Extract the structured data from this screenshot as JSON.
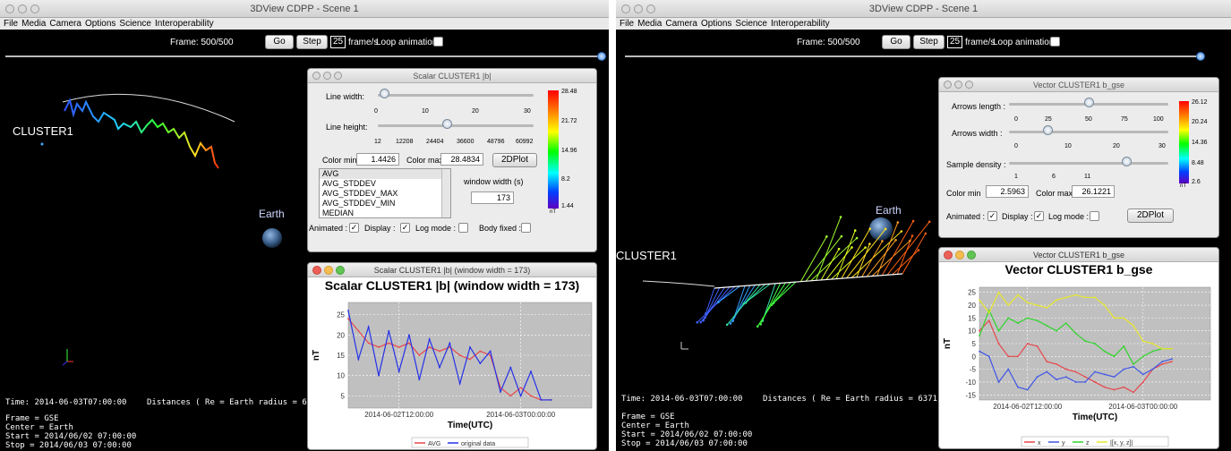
{
  "left": {
    "window_title": "3DView CDPP - Scene 1",
    "menu": [
      "File",
      "Media",
      "Camera",
      "Options",
      "Science",
      "Interoperability"
    ],
    "frame_label": "Frame: 500/500",
    "go_label": "Go",
    "step_label": "Step",
    "fps_value": "25",
    "fps_label": "frame/s",
    "loop_label": "Loop animation",
    "spacecraft_label": "CLUSTER1",
    "earth_label": "Earth",
    "time_status": "Time: 2014-06-03T07:00:00",
    "distances_status": "Distances ( Re = Earth radius = 6371.010km )",
    "frame_info": "Frame = GSE",
    "center_info": "Center = Earth",
    "start_info": "Start = 2014/06/02 07:00:00",
    "stop_info": "Stop = 2014/06/03 07:00:00",
    "scalar_panel": {
      "title": "Scalar CLUSTER1 |b|",
      "line_width_label": "Line width:",
      "line_width_ticks": [
        "0",
        "10",
        "20",
        "30"
      ],
      "line_width_value": 3,
      "line_height_label": "Line height:",
      "line_height_ticks": [
        "12",
        "12208",
        "24404",
        "36600",
        "48796",
        "60992"
      ],
      "line_height_value": 30000,
      "color_min_label": "Color min",
      "color_min_value": "1.4426",
      "color_max_label": "Color max",
      "color_max_value": "28.4834",
      "plot_button": "2DPlot",
      "list_items": [
        "AVG",
        "AVG_STDDEV",
        "AVG_STDDEV_MAX",
        "AVG_STDDEV_MIN",
        "MEDIAN"
      ],
      "window_width_label": "window width (s)",
      "window_width_value": "173",
      "colorbar_ticks": [
        "28.48",
        "21.72",
        "14.96",
        "8.2",
        "1.44"
      ],
      "colorbar_unit": "nT",
      "animated_label": "Animated :",
      "display_label": "Display :",
      "logmode_label": "Log mode :",
      "bodyfixed_label": "Body fixed :",
      "animated_checked": true,
      "display_checked": true,
      "logmode_checked": false,
      "bodyfixed_checked": false
    },
    "scalar_plot_window": {
      "title": "Scalar CLUSTER1 |b| (window width = 173)",
      "plot_title": "Scalar CLUSTER1 |b| (window width = 173)"
    }
  },
  "right": {
    "window_title": "3DView CDPP - Scene 1",
    "menu": [
      "File",
      "Media",
      "Camera",
      "Options",
      "Science",
      "Interoperability"
    ],
    "frame_label": "Frame: 500/500",
    "go_label": "Go",
    "step_label": "Step",
    "fps_value": "25",
    "fps_label": "frame/s",
    "loop_label": "Loop animation",
    "spacecraft_label": "CLUSTER1",
    "earth_label": "Earth",
    "time_status": "Time: 2014-06-03T07:00:00",
    "distances_status": "Distances ( Re = Earth radius = 6371.010km )",
    "frame_info": "Frame = GSE",
    "center_info": "Center = Earth",
    "start_info": "Start = 2014/06/02 07:00:00",
    "stop_info": "Stop = 2014/06/03 07:00:00",
    "vector_panel": {
      "title": "Vector CLUSTER1 b_gse",
      "arrows_length_label": "Arrows length :",
      "arrows_length_ticks": [
        "0",
        "25",
        "50",
        "75",
        "100"
      ],
      "arrows_length_value": 50,
      "arrows_width_label": "Arrows width :",
      "arrows_width_ticks": [
        "0",
        "10",
        "20",
        "30"
      ],
      "arrows_width_value": 10,
      "sample_density_label": "Sample density :",
      "sample_density_ticks": [
        "1",
        "6",
        "11"
      ],
      "sample_density_value": 14,
      "color_min_label": "Color min",
      "color_min_value": "2.5963",
      "color_max_label": "Color max",
      "color_max_value": "26.1221",
      "plot_button": "2DPlot",
      "colorbar_ticks": [
        "26.12",
        "20.24",
        "14.36",
        "8.48",
        "2.6"
      ],
      "colorbar_unit": "nT",
      "animated_label": "Animated :",
      "display_label": "Display :",
      "logmode_label": "Log mode :",
      "animated_checked": true,
      "display_checked": true,
      "logmode_checked": false
    },
    "vector_plot_window": {
      "title": "Vector CLUSTER1 b_gse",
      "plot_title": "Vector CLUSTER1 b_gse"
    }
  },
  "colors": {
    "x_series": "#e8464a",
    "y_series": "#3f56e6",
    "z_series": "#2ed42a",
    "mag_series": "#e8e82a",
    "avg_series": "#e8464a",
    "original_series": "#2431e8",
    "plot_bg": "#c0c0c0"
  },
  "chart_data": [
    {
      "type": "line",
      "title": "Scalar CLUSTER1 |b| (window width = 173)",
      "xlabel": "Time(UTC)",
      "ylabel": "nT",
      "x_ticks": [
        "2014-06-02T12:00:00",
        "2014-06-03T00:00:00"
      ],
      "y_ticks": [
        5,
        10,
        15,
        20,
        25
      ],
      "xlim": [
        "2014-06-02T07:00:00",
        "2014-06-03T07:00:00"
      ],
      "ylim": [
        2,
        28
      ],
      "grid": true,
      "legend_position": "bottom",
      "x": [
        "2014-06-02T07:00:00",
        "2014-06-02T08:00:00",
        "2014-06-02T09:00:00",
        "2014-06-02T10:00:00",
        "2014-06-02T11:00:00",
        "2014-06-02T12:00:00",
        "2014-06-02T13:00:00",
        "2014-06-02T14:00:00",
        "2014-06-02T15:00:00",
        "2014-06-02T16:00:00",
        "2014-06-02T17:00:00",
        "2014-06-02T18:00:00",
        "2014-06-02T19:00:00",
        "2014-06-02T20:00:00",
        "2014-06-02T21:00:00",
        "2014-06-02T22:00:00",
        "2014-06-02T23:00:00",
        "2014-06-03T00:00:00",
        "2014-06-03T01:00:00",
        "2014-06-03T02:00:00",
        "2014-06-03T03:00:00"
      ],
      "series": [
        {
          "name": "AVG",
          "values": [
            24,
            21,
            18,
            17,
            18,
            17,
            18,
            15,
            17,
            16,
            17,
            15,
            14,
            16,
            15,
            7,
            5,
            7,
            5,
            4,
            4
          ]
        },
        {
          "name": "original data",
          "values": [
            26,
            14,
            22,
            10,
            21,
            11,
            20,
            9,
            19,
            12,
            18,
            8,
            17,
            13,
            16,
            6,
            12,
            5,
            11,
            4,
            4
          ]
        }
      ]
    },
    {
      "type": "line",
      "title": "Vector CLUSTER1 b_gse",
      "xlabel": "Time(UTC)",
      "ylabel": "nT",
      "x_ticks": [
        "2014-06-02T12:00:00",
        "2014-06-03T00:00:00"
      ],
      "y_ticks": [
        -15,
        -10,
        -5,
        0,
        5,
        10,
        15,
        20,
        25
      ],
      "xlim": [
        "2014-06-02T07:00:00",
        "2014-06-03T07:00:00"
      ],
      "ylim": [
        -17,
        27
      ],
      "grid": true,
      "legend_position": "bottom",
      "x": [
        "2014-06-02T07:00:00",
        "2014-06-02T08:00:00",
        "2014-06-02T09:00:00",
        "2014-06-02T10:00:00",
        "2014-06-02T11:00:00",
        "2014-06-02T12:00:00",
        "2014-06-02T13:00:00",
        "2014-06-02T14:00:00",
        "2014-06-02T15:00:00",
        "2014-06-02T16:00:00",
        "2014-06-02T17:00:00",
        "2014-06-02T18:00:00",
        "2014-06-02T19:00:00",
        "2014-06-02T20:00:00",
        "2014-06-02T21:00:00",
        "2014-06-02T22:00:00",
        "2014-06-02T23:00:00",
        "2014-06-03T00:00:00",
        "2014-06-03T01:00:00",
        "2014-06-03T02:00:00",
        "2014-06-03T03:00:00"
      ],
      "series": [
        {
          "name": "x",
          "values": [
            10,
            14,
            5,
            0,
            0,
            5,
            4,
            -2,
            -3,
            -5,
            -6,
            -8,
            -10,
            -12,
            -13,
            -12,
            -14,
            -10,
            -5,
            -3,
            -2
          ]
        },
        {
          "name": "y",
          "values": [
            2,
            0,
            -10,
            -5,
            -12,
            -13,
            -8,
            -6,
            -9,
            -8,
            -10,
            -10,
            -6,
            -7,
            -8,
            -5,
            -4,
            -7,
            -5,
            -2,
            -1
          ]
        },
        {
          "name": "z",
          "values": [
            8,
            18,
            10,
            15,
            13,
            15,
            14,
            12,
            10,
            13,
            9,
            6,
            5,
            2,
            0,
            4,
            -3,
            0,
            2,
            3,
            3
          ]
        },
        {
          "name": "|[x, y, z]|",
          "values": [
            22,
            17,
            25,
            20,
            24,
            21,
            20,
            19,
            22,
            23,
            24,
            23,
            23,
            20,
            15,
            15,
            12,
            6,
            5,
            3,
            3
          ]
        }
      ]
    }
  ]
}
